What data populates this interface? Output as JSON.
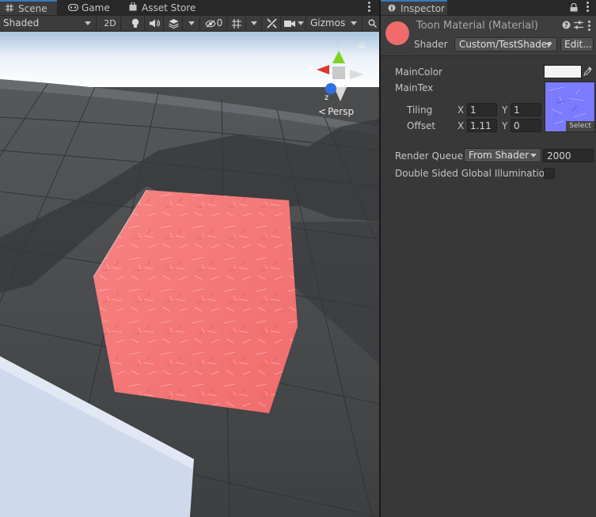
{
  "scene_tabs": [
    {
      "label": "Scene",
      "icon": "grid-icon",
      "active": true
    },
    {
      "label": "Game",
      "icon": "gamepad-icon",
      "active": false
    },
    {
      "label": "Asset Store",
      "icon": "shopping-bag-icon",
      "active": false
    }
  ],
  "scene_toolbar": {
    "shading_mode": "Shaded",
    "mode_2d": "2D",
    "hidden_count": "0",
    "gizmos_label": "Gizmos"
  },
  "scene_view": {
    "projection_label": "Persp",
    "axis_labels": {
      "y": "y",
      "x": "x",
      "z": "z"
    }
  },
  "inspector": {
    "tab_label": "Inspector",
    "material_title": "Toon Material (Material)",
    "material_color": "#f06b6b",
    "shader_label": "Shader",
    "shader_value": "Custom/TestShader",
    "edit_button": "Edit...",
    "main_color_label": "MainColor",
    "main_color_value": "#f4f4f4",
    "main_tex_label": "MainTex",
    "tiling_label": "Tiling",
    "offset_label": "Offset",
    "tiling": {
      "x_label": "X",
      "x": "1",
      "y_label": "Y",
      "y": "1"
    },
    "offset": {
      "x_label": "X",
      "x": "1.11",
      "y_label": "Y",
      "y": "0"
    },
    "select_button": "Select",
    "render_queue_label": "Render Queue",
    "render_queue_mode": "From Shader",
    "render_queue_value": "2000",
    "double_sided_label": "Double Sided Global Illumination",
    "double_sided_checked": false
  },
  "colors": {
    "accent": "#3a79bb",
    "cube": "#f07575",
    "texture": "#7b7bff"
  }
}
